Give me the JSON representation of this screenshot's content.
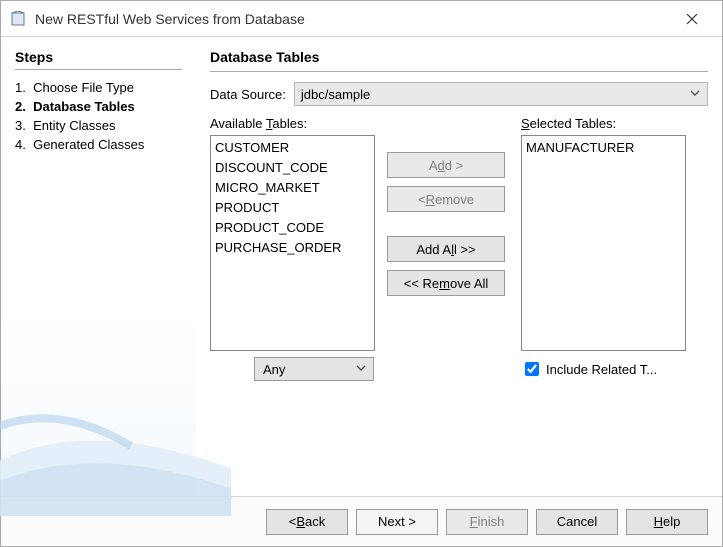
{
  "title": "New RESTful Web Services from Database",
  "sidebar": {
    "heading": "Steps",
    "steps": [
      {
        "num": "1.",
        "label": "Choose File Type"
      },
      {
        "num": "2.",
        "label": "Database Tables"
      },
      {
        "num": "3.",
        "label": "Entity Classes"
      },
      {
        "num": "4.",
        "label": "Generated Classes"
      }
    ],
    "current_index": 1
  },
  "main": {
    "heading": "Database Tables",
    "data_source_label": "Data Source:",
    "data_source_value": "jdbc/sample",
    "available_label": "Available Tables:",
    "selected_label": "Selected Tables:",
    "available_tables": [
      "CUSTOMER",
      "DISCOUNT_CODE",
      "MICRO_MARKET",
      "PRODUCT",
      "PRODUCT_CODE",
      "PURCHASE_ORDER"
    ],
    "selected_tables": [
      "MANUFACTURER"
    ],
    "buttons": {
      "add": "Add >",
      "remove": "< Remove",
      "add_all": "Add All >>",
      "remove_all": "<< Remove All"
    },
    "filter_value": "Any",
    "include_related_label": "Include Related T...",
    "include_related_checked": true
  },
  "footer": {
    "back": "< Back",
    "next": "Next >",
    "finish": "Finish",
    "cancel": "Cancel",
    "help": "Help"
  }
}
